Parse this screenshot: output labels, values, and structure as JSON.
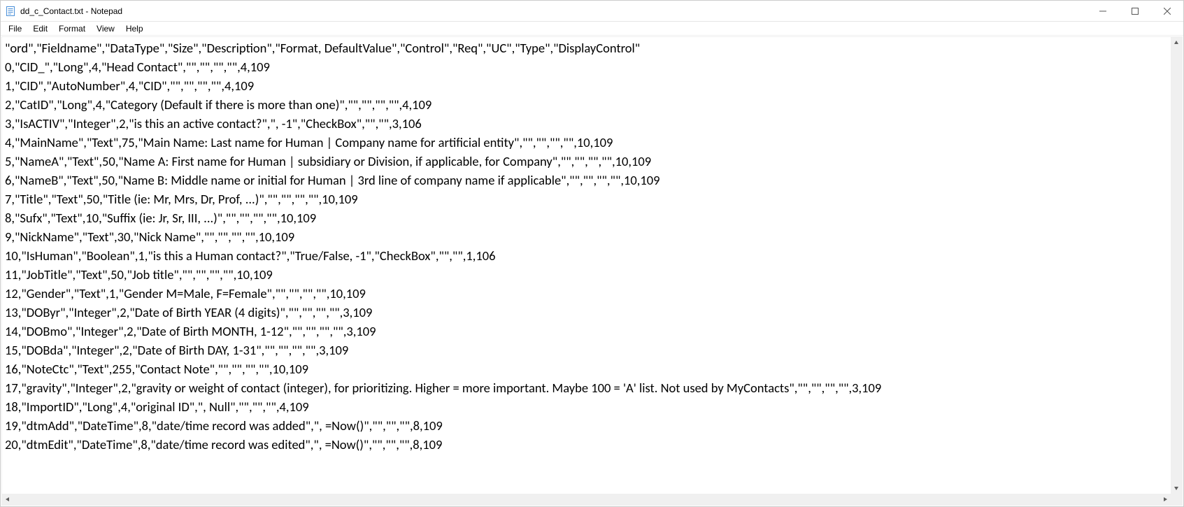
{
  "window": {
    "title": "dd_c_Contact.txt - Notepad"
  },
  "menu": {
    "file": "File",
    "edit": "Edit",
    "format": "Format",
    "view": "View",
    "help": "Help"
  },
  "content": {
    "lines": [
      "\"ord\",\"Fieldname\",\"DataType\",\"Size\",\"Description\",\"Format, DefaultValue\",\"Control\",\"Req\",\"UC\",\"Type\",\"DisplayControl\"",
      "0,\"CID_\",\"Long\",4,\"Head Contact\",\"\",\"\",\"\",\"\",4,109",
      "1,\"CID\",\"AutoNumber\",4,\"CID\",\"\",\"\",\"\",\"\",4,109",
      "2,\"CatID\",\"Long\",4,\"Category (Default if there is more than one)\",\"\",\"\",\"\",\"\",4,109",
      "3,\"IsACTIV\",\"Integer\",2,\"is this an active contact?\",\", -1\",\"CheckBox\",\"\",\"\",3,106",
      "4,\"MainName\",\"Text\",75,\"Main Name: Last name for Human | Company name for artificial entity\",\"\",\"\",\"\",\"\",10,109",
      "5,\"NameA\",\"Text\",50,\"Name A: First name for Human | subsidiary or Division, if applicable, for Company\",\"\",\"\",\"\",\"\",10,109",
      "6,\"NameB\",\"Text\",50,\"Name B: Middle name or initial for Human | 3rd line of company name if applicable\",\"\",\"\",\"\",\"\",10,109",
      "7,\"Title\",\"Text\",50,\"Title (ie: Mr, Mrs, Dr, Prof, ...)\",\"\",\"\",\"\",\"\",10,109",
      "8,\"Sufx\",\"Text\",10,\"Suffix (ie: Jr, Sr, III, ...)\",\"\",\"\",\"\",\"\",10,109",
      "9,\"NickName\",\"Text\",30,\"Nick Name\",\"\",\"\",\"\",\"\",10,109",
      "10,\"IsHuman\",\"Boolean\",1,\"is this a Human contact?\",\"True/False, -1\",\"CheckBox\",\"\",\"\",1,106",
      "11,\"JobTitle\",\"Text\",50,\"Job title\",\"\",\"\",\"\",\"\",10,109",
      "12,\"Gender\",\"Text\",1,\"Gender M=Male, F=Female\",\"\",\"\",\"\",\"\",10,109",
      "13,\"DOByr\",\"Integer\",2,\"Date of Birth YEAR (4 digits)\",\"\",\"\",\"\",\"\",3,109",
      "14,\"DOBmo\",\"Integer\",2,\"Date of Birth MONTH, 1-12\",\"\",\"\",\"\",\"\",3,109",
      "15,\"DOBda\",\"Integer\",2,\"Date of Birth DAY, 1-31\",\"\",\"\",\"\",\"\",3,109",
      "16,\"NoteCtc\",\"Text\",255,\"Contact Note\",\"\",\"\",\"\",\"\",10,109",
      "17,\"gravity\",\"Integer\",2,\"gravity or weight of contact (integer), for prioritizing. Higher = more important. Maybe 100 = 'A' list. Not used by MyContacts\",\"\",\"\",\"\",\"\",3,109",
      "18,\"ImportID\",\"Long\",4,\"original ID\",\", Null\",\"\",\"\",\"\",4,109",
      "19,\"dtmAdd\",\"DateTime\",8,\"date/time record was added\",\", =Now()\",\"\",\"\",\"\",8,109",
      "20,\"dtmEdit\",\"DateTime\",8,\"date/time record was edited\",\", =Now()\",\"\",\"\",\"\",8,109"
    ]
  }
}
